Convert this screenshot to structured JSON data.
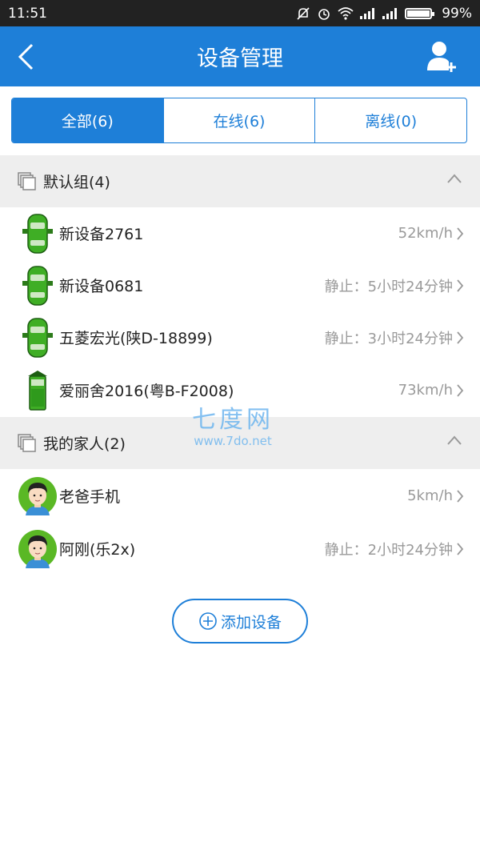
{
  "statusbar": {
    "time": "11:51",
    "battery": "99%"
  },
  "appbar": {
    "title": "设备管理"
  },
  "tabs": [
    {
      "label": "全部(6)",
      "active": true
    },
    {
      "label": "在线(6)",
      "active": false
    },
    {
      "label": "离线(0)",
      "active": false
    }
  ],
  "groups": [
    {
      "name": "默认组(4)",
      "devices": [
        {
          "name": "新设备2761",
          "status": "52km/h",
          "icon": "car-icon"
        },
        {
          "name": "新设备0681",
          "status": "静止：5小时24分钟",
          "icon": "car-icon"
        },
        {
          "name": "五菱宏光(陕D-18899)",
          "status": "静止：3小时24分钟",
          "icon": "car-icon"
        },
        {
          "name": "爱丽舍2016(粤B-F2008)",
          "status": "73km/h",
          "icon": "car-icon"
        }
      ]
    },
    {
      "name": "我的家人(2)",
      "devices": [
        {
          "name": "老爸手机",
          "status": "5km/h",
          "icon": "person-avatar-icon"
        },
        {
          "name": "阿刚(乐2x)",
          "status": "静止：2小时24分钟",
          "icon": "person-avatar-icon"
        }
      ]
    }
  ],
  "add_button": {
    "label": "添加设备"
  },
  "watermark": {
    "line1": "七度网",
    "line2": "www.7do.net"
  },
  "colors": {
    "primary": "#1e7fd8",
    "car_green": "#3fae25"
  }
}
